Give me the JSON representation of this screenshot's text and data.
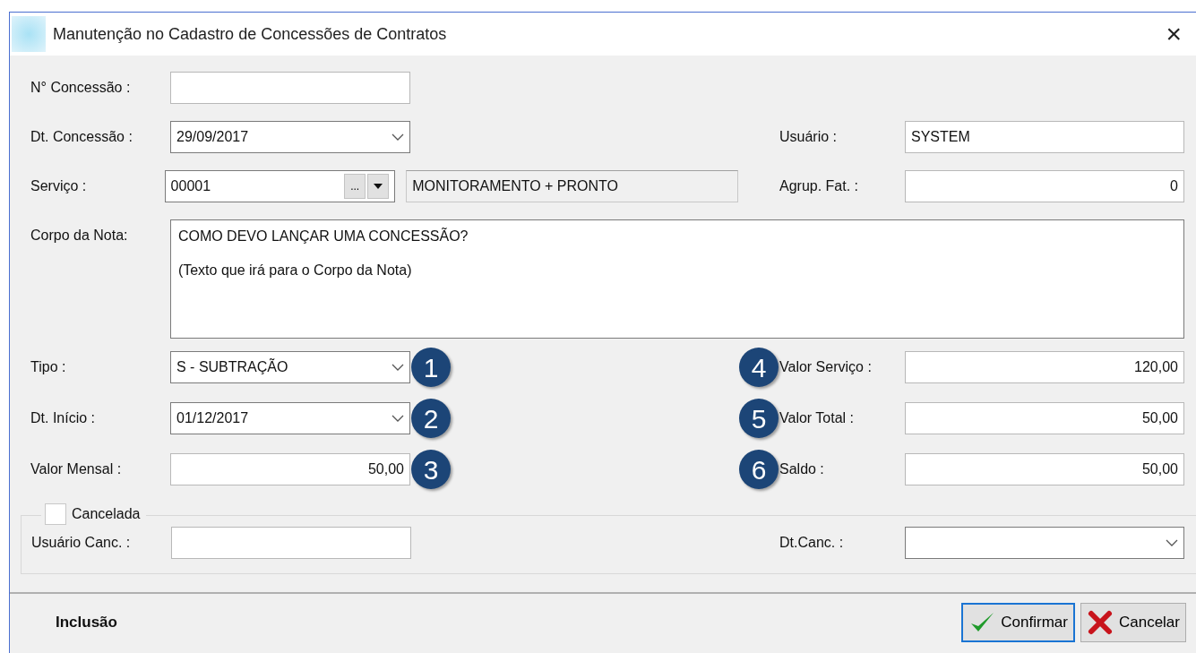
{
  "window": {
    "title": "Manutenção no Cadastro de Concessões de Contratos",
    "close": "×"
  },
  "rows": [
    {
      "left": {
        "kind": "text",
        "label": "N° Concessão :"
      }
    },
    {
      "left": {
        "kind": "combo",
        "label": "Dt. Concessão :",
        "value": "29/09/2017"
      },
      "right": {
        "kind": "text",
        "label": "Usuário :",
        "value": "SYSTEM"
      }
    },
    {
      "left": {
        "kind": "lookup",
        "label": "Serviço :",
        "value": "00001",
        "ellipsis": "...",
        "description": "MONITORAMENTO + PRONTO"
      },
      "right": {
        "kind": "text",
        "label": "Agrup. Fat. :",
        "value": "0",
        "numeric": true
      }
    },
    {
      "left": {
        "kind": "memo",
        "label": "Corpo da Nota:",
        "lines": [
          "COMO DEVO LANÇAR UMA CONCESSÃO?",
          "(Texto que irá para o Corpo da Nota)"
        ]
      }
    },
    {
      "left": {
        "kind": "combo",
        "label": "Tipo :",
        "value": "S - SUBTRAÇÃO",
        "marker": "1"
      },
      "right": {
        "kind": "text",
        "label": "Valor Serviço :",
        "value": "120,00",
        "numeric": true,
        "marker": "4"
      }
    },
    {
      "left": {
        "kind": "combo",
        "label": "Dt. Início :",
        "value": "01/12/2017",
        "marker": "2"
      },
      "right": {
        "kind": "text",
        "label": "Valor Total :",
        "value": "50,00",
        "numeric": true,
        "marker": "5"
      }
    },
    {
      "left": {
        "kind": "text",
        "label": "Valor Mensal :",
        "value": "50,00",
        "numeric": true,
        "marker": "3"
      },
      "right": {
        "kind": "text",
        "label": "Saldo :",
        "value": "50,00",
        "numeric": true,
        "marker": "6"
      }
    }
  ],
  "cancel_group": {
    "label": "Cancelada",
    "checked": false,
    "left": {
      "kind": "text",
      "label": "Usuário Canc. :"
    },
    "right": {
      "kind": "combo",
      "label": "Dt.Canc. :"
    }
  },
  "footer": {
    "status": "Inclusão",
    "buttons": [
      {
        "kind": "confirm",
        "label": "Confirmar",
        "default": true
      },
      {
        "kind": "cancel",
        "label": "Cancelar",
        "default": false
      }
    ]
  }
}
